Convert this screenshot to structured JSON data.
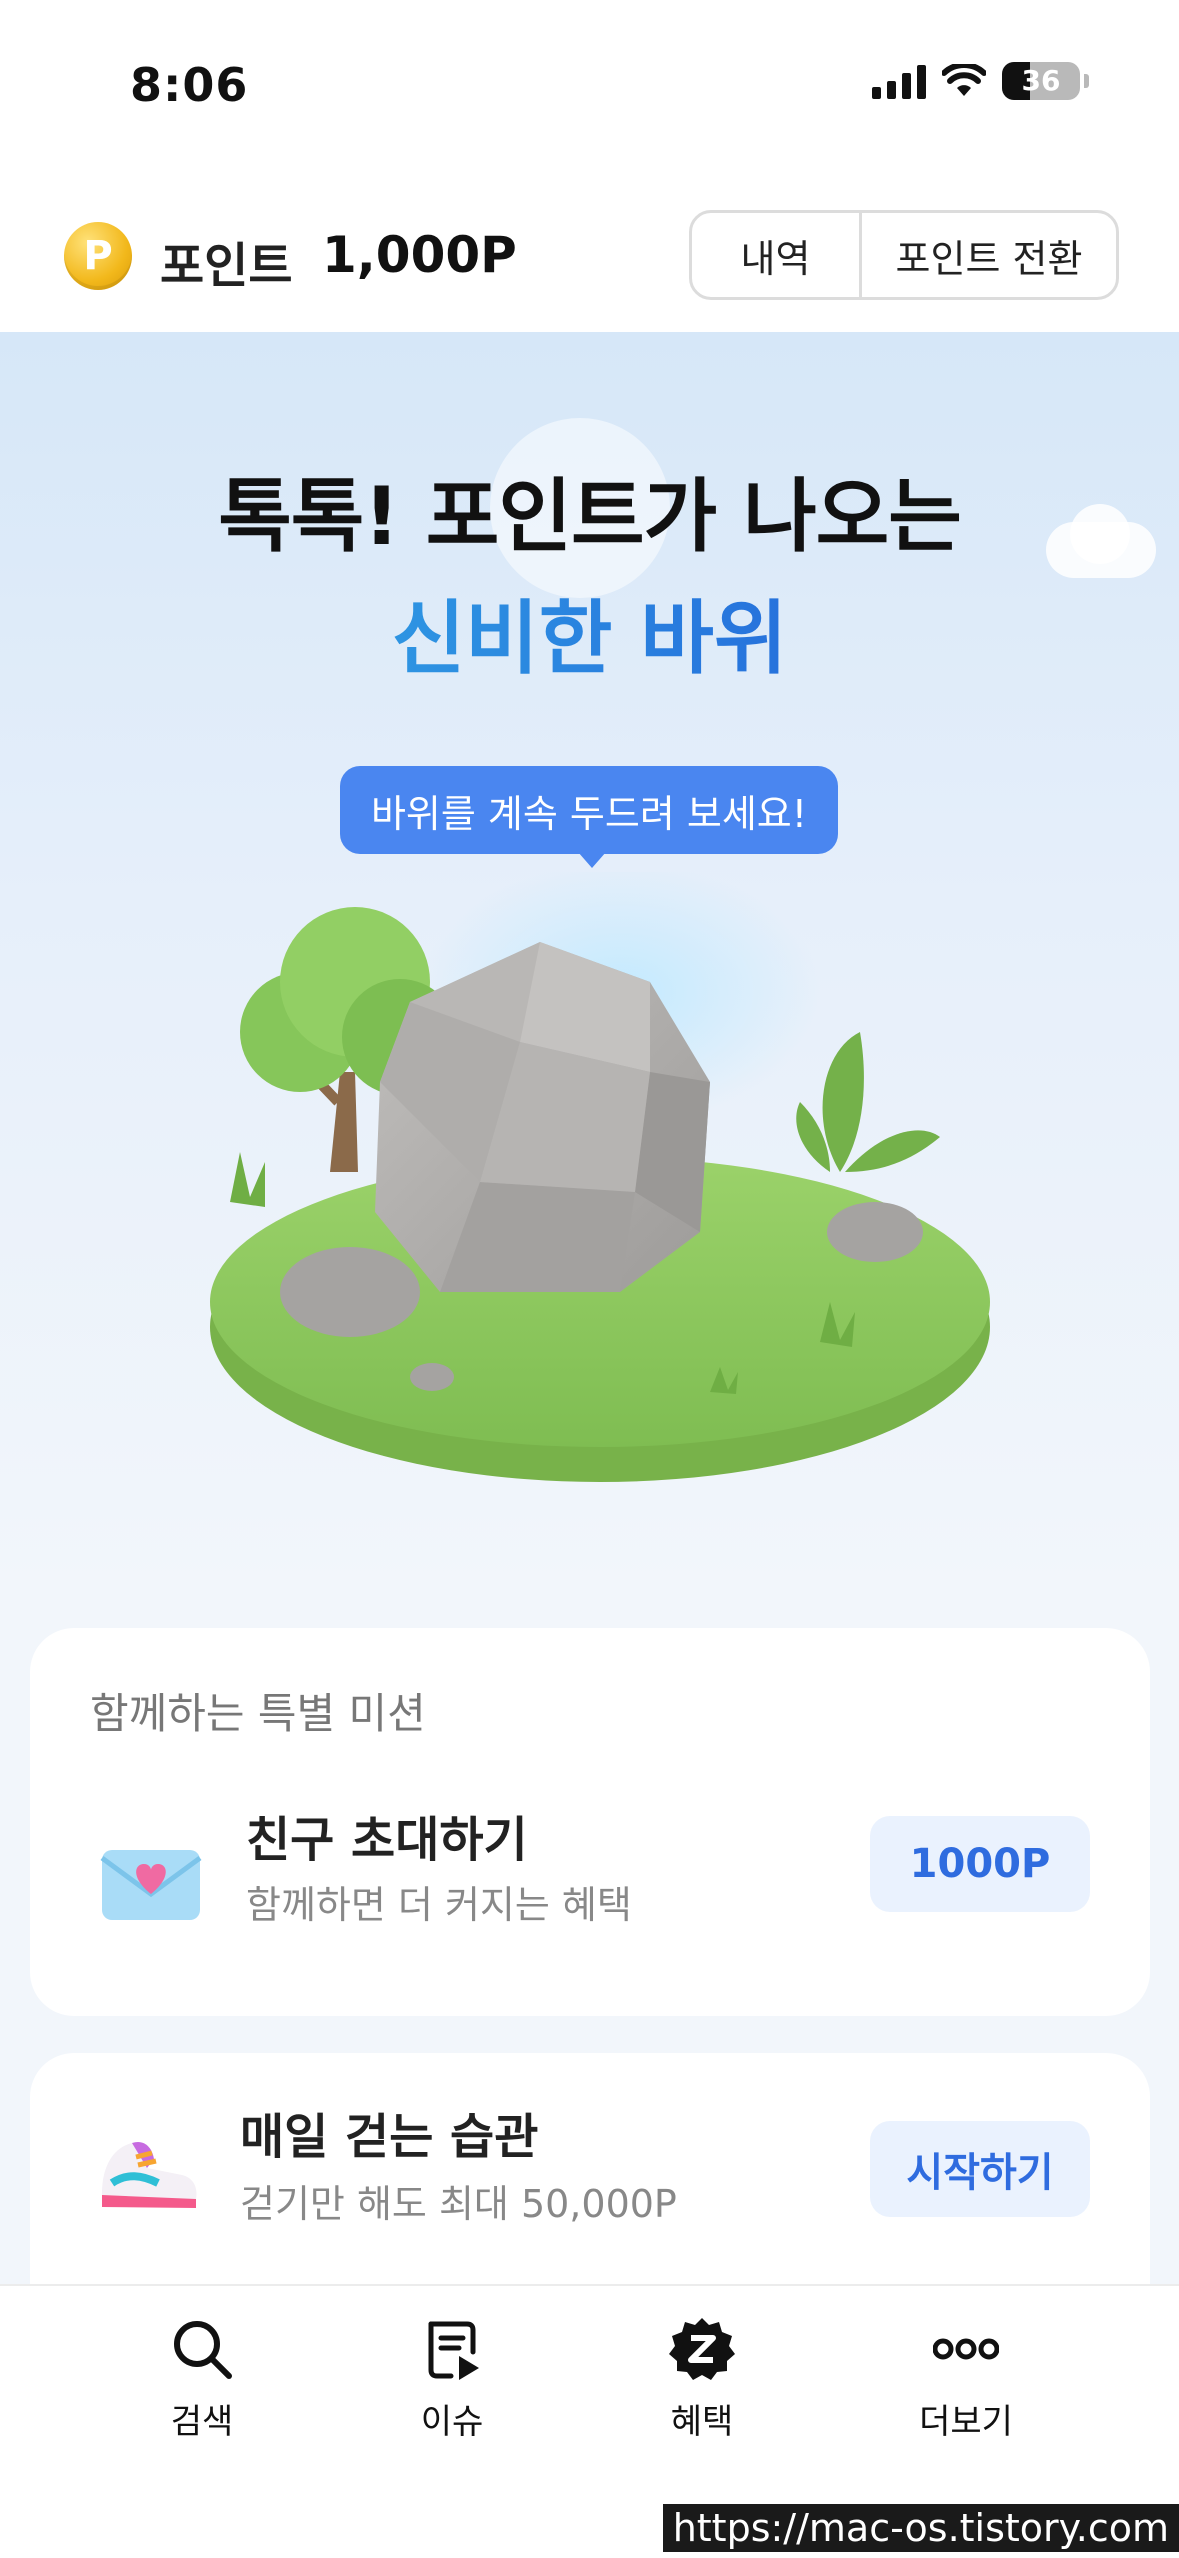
{
  "status_bar": {
    "time": "8:06",
    "battery": "36",
    "battery_level": 0.36
  },
  "header": {
    "coin_letter": "P",
    "label": "포인트",
    "value": "1,000P",
    "history_button": "내역",
    "convert_button": "포인트 전환"
  },
  "hero": {
    "title": "톡톡! 포인트가 나오는",
    "subtitle": "신비한 바위",
    "bubble": "바위를 계속 두드려 보세요!"
  },
  "missions": {
    "section_title": "함께하는 특별 미션",
    "invite": {
      "icon": "envelope-heart-icon",
      "name": "친구 초대하기",
      "desc": "함께하면 더 커지는 혜택",
      "button": "1000P"
    },
    "walk": {
      "icon": "sneaker-icon",
      "name": "매일 걷는 습관",
      "desc": "걷기만 해도 최대 50,000P",
      "button": "시작하기"
    }
  },
  "bottom_nav": {
    "items": [
      {
        "label": "검색",
        "icon": "search-icon"
      },
      {
        "label": "이슈",
        "icon": "issue-doc-icon"
      },
      {
        "label": "혜택",
        "icon": "benefit-badge-icon"
      },
      {
        "label": "더보기",
        "icon": "more-icon"
      }
    ]
  },
  "watermark": "https://mac-os.tistory.com",
  "colors": {
    "accent": "#2f6cdf",
    "bubble": "#4a86f0",
    "coin": "#f2b81b",
    "grass": "#8cc85e",
    "rock": "#a9a7a5"
  }
}
